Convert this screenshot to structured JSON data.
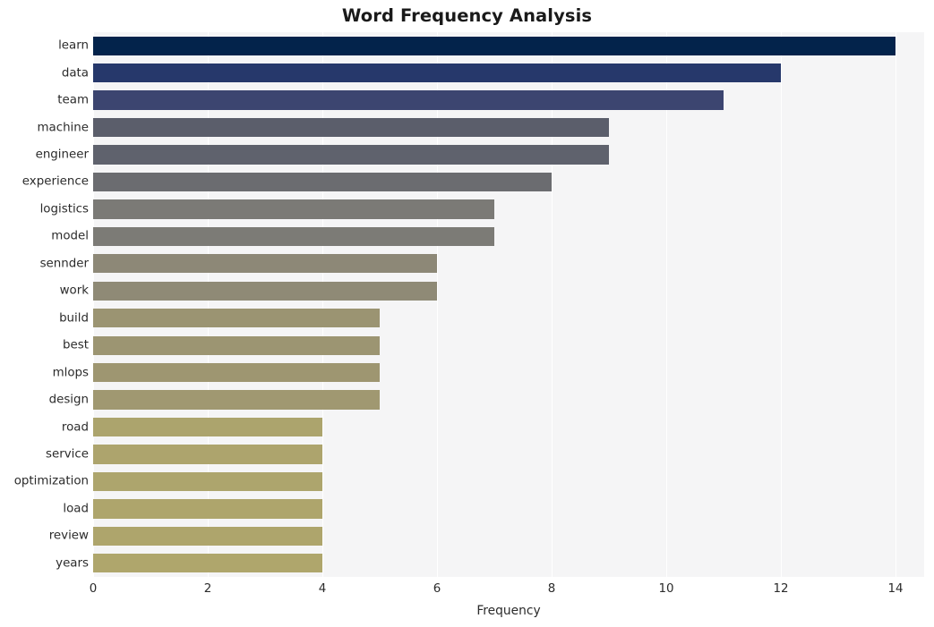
{
  "chart_data": {
    "type": "bar",
    "orientation": "horizontal",
    "title": "Word Frequency Analysis",
    "xlabel": "Frequency",
    "ylabel": "",
    "xlim": [
      0,
      14.5
    ],
    "xticks": [
      0,
      2,
      4,
      6,
      8,
      10,
      12,
      14
    ],
    "xtick_labels": [
      "0",
      "2",
      "4",
      "6",
      "8",
      "10",
      "12",
      "14"
    ],
    "grid": "vertical-only",
    "legend": "none",
    "categories": [
      "learn",
      "data",
      "team",
      "machine",
      "engineer",
      "experience",
      "logistics",
      "model",
      "sennder",
      "work",
      "build",
      "best",
      "mlops",
      "design",
      "road",
      "service",
      "optimization",
      "load",
      "review",
      "years"
    ],
    "values": [
      14,
      12,
      11,
      9,
      9,
      8,
      7,
      7,
      6,
      6,
      5,
      5,
      5,
      5,
      4,
      4,
      4,
      4,
      4,
      4
    ],
    "bar_colors": [
      "#03234b",
      "#26386b",
      "#3c4570",
      "#5b5e6b",
      "#5f626d",
      "#6b6c70",
      "#7b7a76",
      "#7c7b76",
      "#8d8877",
      "#8f8a76",
      "#9b9472",
      "#9c9572",
      "#9e9671",
      "#a09871",
      "#aca46d",
      "#ada46d",
      "#ada56d",
      "#aea56c",
      "#aea56c",
      "#afa66c"
    ],
    "plot_background": "#f5f5f6",
    "grid_color": "#ffffff",
    "figure_background": "#ffffff",
    "text_color": "#2b2b2b"
  }
}
